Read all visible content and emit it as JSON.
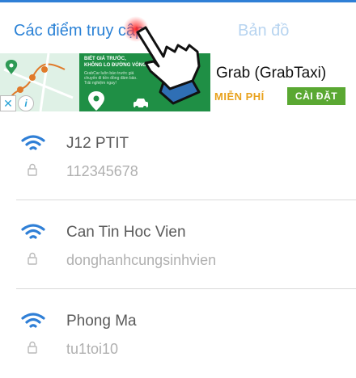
{
  "tabs": [
    {
      "label": "Các điểm truy cập",
      "active": true
    },
    {
      "label": "Bản đồ",
      "active": false
    }
  ],
  "ad": {
    "headline_1": "BIẾT GIÁ TRƯỚC,",
    "headline_2": "KHÔNG LO ĐƯỜNG VÒNG",
    "body": "GrabCar luôn báo trước giá chuyến đi tiền đồng đảm bảo. Trải nghiệm ngay!",
    "app_title": "Grab (GrabTaxi)",
    "price_label": "MIỄN PHÍ",
    "install_label": "CÀI ĐẶT",
    "close_icon": "close-icon",
    "info_icon": "info-icon"
  },
  "hotspots": [
    {
      "name": "J12 PTIT",
      "password": "112345678"
    },
    {
      "name": "Can Tin Hoc Vien",
      "password": "donghanhcungsinhvien"
    },
    {
      "name": "Phong Ma",
      "password": "tu1toi10"
    }
  ],
  "colors": {
    "accent": "#2b82d6",
    "tab_inactive": "#b7d4f0",
    "wifi": "#2f7fd6",
    "ad_green": "#1f8f45",
    "free": "#e8a11b",
    "install": "#5aa832"
  }
}
